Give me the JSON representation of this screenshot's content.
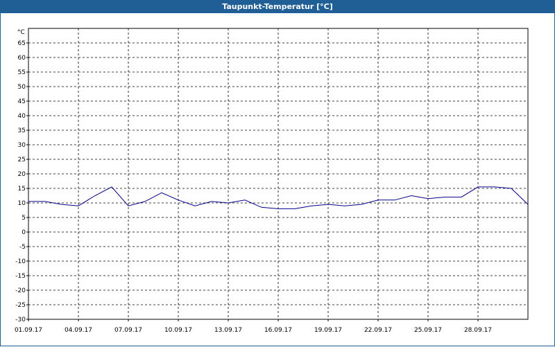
{
  "window": {
    "title": "Taupunkt-Temperatur [°C]",
    "title_bar_color": "#1f5f96"
  },
  "chart_data": {
    "type": "line",
    "title": "Taupunkt-Temperatur [°C]",
    "ylabel": "°C",
    "xlabel": "",
    "ylim": [
      -30,
      70
    ],
    "yticks": [
      65,
      60,
      55,
      50,
      45,
      40,
      35,
      30,
      25,
      20,
      15,
      10,
      5,
      0,
      -5,
      -10,
      -15,
      -20,
      -25,
      -30
    ],
    "xlim": [
      "2017-09-01",
      "2017-10-01"
    ],
    "xticks": [
      "01.09.17",
      "04.09.17",
      "07.09.17",
      "10.09.17",
      "13.09.17",
      "16.09.17",
      "19.09.17",
      "22.09.17",
      "25.09.17",
      "28.09.17"
    ],
    "grid": true,
    "line_color": "#00008b",
    "series": [
      {
        "x": [
          "2017-09-01",
          "2017-09-02",
          "2017-09-03",
          "2017-09-04",
          "2017-09-05",
          "2017-09-06",
          "2017-09-07",
          "2017-09-08",
          "2017-09-09",
          "2017-09-10",
          "2017-09-11",
          "2017-09-12",
          "2017-09-13",
          "2017-09-14",
          "2017-09-15",
          "2017-09-16",
          "2017-09-17",
          "2017-09-18",
          "2017-09-19",
          "2017-09-20",
          "2017-09-21",
          "2017-09-22",
          "2017-09-23",
          "2017-09-24",
          "2017-09-25",
          "2017-09-26",
          "2017-09-27",
          "2017-09-28",
          "2017-09-29",
          "2017-09-30",
          "2017-10-01"
        ],
        "values": [
          10.5,
          10.5,
          9.5,
          9,
          12.5,
          15.5,
          9,
          10.5,
          13.5,
          11,
          9,
          10.5,
          10,
          11,
          8.5,
          8,
          8,
          9,
          9.5,
          9,
          9.5,
          11,
          11,
          12.5,
          11.5,
          12,
          12,
          15.5,
          15.5,
          15,
          9.5
        ]
      }
    ]
  }
}
